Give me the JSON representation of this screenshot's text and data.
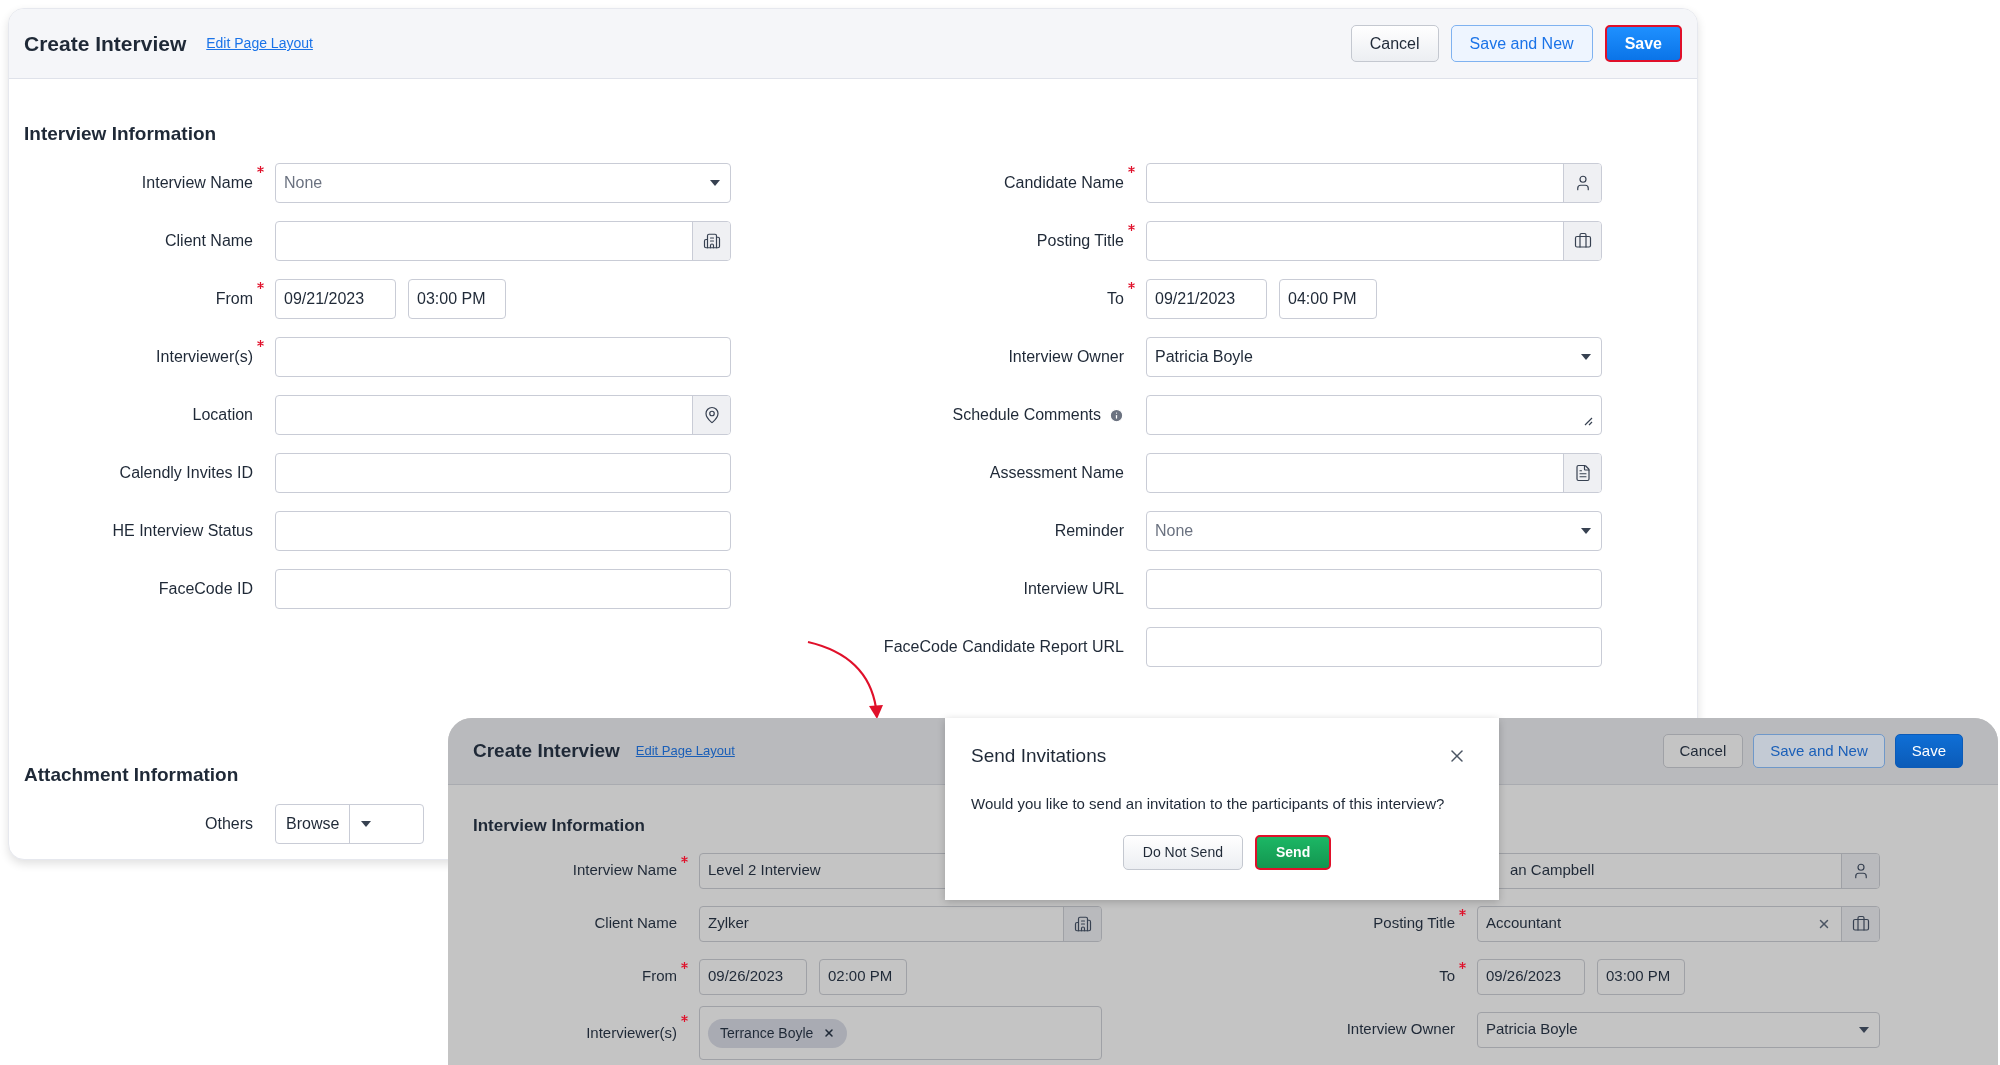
{
  "main_form": {
    "title": "Create Interview",
    "edit_link": "Edit Page Layout",
    "buttons": [
      {
        "label": "Cancel",
        "kind": "default",
        "highlighted": false
      },
      {
        "label": "Save and New",
        "kind": "outline",
        "highlighted": false
      },
      {
        "label": "Save",
        "kind": "primary",
        "highlighted": true
      }
    ],
    "sections": [
      {
        "title": "Interview Information",
        "left": [
          {
            "label": "Interview Name",
            "required": true,
            "kind": "select",
            "placeholder": "None"
          },
          {
            "label": "Client Name",
            "required": false,
            "kind": "account"
          },
          {
            "label": "From",
            "required": true,
            "kind": "datetime",
            "date": "09/21/2023",
            "time": "03:00 PM"
          },
          {
            "label": "Interviewer(s)",
            "required": true,
            "kind": "text"
          },
          {
            "label": "Location",
            "required": false,
            "kind": "location"
          },
          {
            "label": "Calendly Invites ID",
            "required": false,
            "kind": "text"
          },
          {
            "label": "HE Interview Status",
            "required": false,
            "kind": "text"
          },
          {
            "label": "FaceCode ID",
            "required": false,
            "kind": "text"
          }
        ],
        "right": [
          {
            "label": "Candidate Name",
            "required": true,
            "kind": "contact"
          },
          {
            "label": "Posting Title",
            "required": true,
            "kind": "job"
          },
          {
            "label": "To",
            "required": true,
            "kind": "datetime",
            "date": "09/21/2023",
            "time": "04:00 PM"
          },
          {
            "label": "Interview Owner",
            "required": false,
            "kind": "select",
            "value": "Patricia Boyle"
          },
          {
            "label": "Schedule Comments",
            "required": false,
            "kind": "textarea",
            "info": true
          },
          {
            "label": "Assessment Name",
            "required": false,
            "kind": "assessment"
          },
          {
            "label": "Reminder",
            "required": false,
            "kind": "select",
            "placeholder": "None"
          },
          {
            "label": "Interview URL",
            "required": false,
            "kind": "text"
          },
          {
            "label": "FaceCode Candidate Report URL",
            "required": false,
            "kind": "text"
          }
        ]
      },
      {
        "title": "Attachment Information",
        "left": [
          {
            "label": "Others",
            "required": false,
            "kind": "file",
            "button": "Browse"
          }
        ]
      }
    ]
  },
  "overlay_form": {
    "title": "Create Interview",
    "edit_link": "Edit Page Layout",
    "buttons": [
      {
        "label": "Cancel",
        "kind": "default",
        "highlighted": false
      },
      {
        "label": "Save and New",
        "kind": "outline",
        "highlighted": false
      },
      {
        "label": "Save",
        "kind": "primary",
        "highlighted": false
      }
    ],
    "section_title": "Interview Information",
    "left": [
      {
        "label": "Interview Name",
        "required": true,
        "kind": "text",
        "value": "Level 2 Interview"
      },
      {
        "label": "Client Name",
        "required": false,
        "kind": "account",
        "value": "Zylker"
      },
      {
        "label": "From",
        "required": true,
        "kind": "datetime",
        "date": "09/26/2023",
        "time": "02:00 PM"
      },
      {
        "label": "Interviewer(s)",
        "required": true,
        "kind": "tags",
        "tags": [
          "Terrance Boyle"
        ]
      }
    ],
    "right": [
      {
        "kind": "contact",
        "value": "an Campbell"
      },
      {
        "label": "Posting Title",
        "required": true,
        "kind": "job",
        "value": "Accountant",
        "clearable": true
      },
      {
        "label": "To",
        "required": true,
        "kind": "datetime",
        "date": "09/26/2023",
        "time": "03:00 PM"
      },
      {
        "label": "Interview Owner",
        "required": false,
        "kind": "select",
        "value": "Patricia Boyle"
      }
    ]
  },
  "dialog": {
    "title": "Send Invitations",
    "message": "Would you like to send an invitation to the participants of this interview?",
    "buttons": [
      {
        "label": "Do Not Send",
        "kind": "default",
        "highlighted": false
      },
      {
        "label": "Send",
        "kind": "success",
        "highlighted": true
      }
    ]
  }
}
